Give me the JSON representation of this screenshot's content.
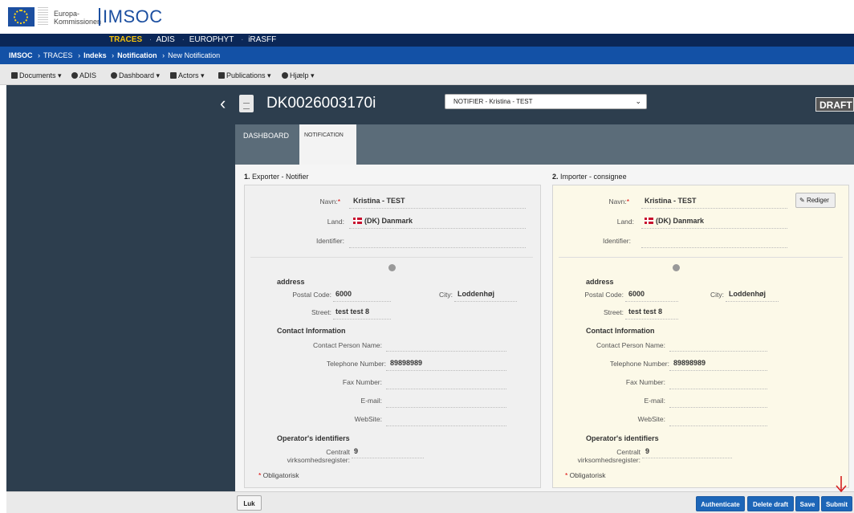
{
  "brand": {
    "line1": "Europa-",
    "line2": "Kommissionen",
    "app": "IMSOC"
  },
  "apps": {
    "active": "TRACES",
    "items": [
      "ADIS",
      "EUROPHYT",
      "iRASFF"
    ]
  },
  "breadcrumb": {
    "root": "IMSOC",
    "traces": "TRACES",
    "index": "Indeks",
    "notification": "Notification",
    "current": "New Notification"
  },
  "menu": {
    "documents": "Documents ▾",
    "adis": "ADIS",
    "dashboard": "Dashboard ▾",
    "actors": "Actors ▾",
    "publications": "Publications ▾",
    "help": "Hjælp ▾"
  },
  "header": {
    "certificate_id": "DK0026003170i",
    "role_select": "NOTIFIER - Kristina - TEST",
    "status": "DRAFT"
  },
  "tabs": {
    "dashboard": "DASHBOARD",
    "notification": "NOTIFICATION"
  },
  "exporter": {
    "section_num": "1.",
    "section_title": "Exporter - Notifier",
    "name_label": "Navn:",
    "name": "Kristina - TEST",
    "country_label": "Land:",
    "country": "(DK) Danmark",
    "identifier_label": "Identifier:",
    "address_heading": "address",
    "postal_code_label": "Postal Code:",
    "postal_code": "6000",
    "city_label": "City:",
    "city": "Loddenhøj",
    "street_label": "Street:",
    "street": "test test 8",
    "contact_heading": "Contact Information",
    "contact_person_label": "Contact Person Name:",
    "telephone_label": "Telephone Number:",
    "telephone": "89898989",
    "fax_label": "Fax Number:",
    "email_label": "E-mail:",
    "website_label": "WebSite:",
    "operator_heading": "Operator's identifiers",
    "cvr_label_1": "Centralt",
    "cvr_label_2": "virksomhedsregister:",
    "cvr": "9",
    "required_note": "Obligatorisk"
  },
  "importer": {
    "section_num": "2.",
    "section_title": "Importer - consignee",
    "edit_button": "Rediger",
    "name_label": "Navn:",
    "name": "Kristina - TEST",
    "country_label": "Land:",
    "country": "(DK) Danmark",
    "identifier_label": "Identifier:",
    "address_heading": "address",
    "postal_code_label": "Postal Code:",
    "postal_code": "6000",
    "city_label": "City:",
    "city": "Loddenhøj",
    "street_label": "Street:",
    "street": "test test 8",
    "contact_heading": "Contact Information",
    "contact_person_label": "Contact Person Name:",
    "telephone_label": "Telephone Number:",
    "telephone": "89898989",
    "fax_label": "Fax Number:",
    "email_label": "E-mail:",
    "website_label": "WebSite:",
    "operator_heading": "Operator's identifiers",
    "cvr_label_1": "Centralt",
    "cvr_label_2": "virksomhedsregister:",
    "cvr": "9",
    "required_note": "Obligatorisk"
  },
  "footer": {
    "close": "Luk",
    "authenticate": "Authenticate",
    "delete_draft": "Delete draft",
    "save": "Save",
    "submit": "Submit"
  },
  "colors": {
    "brand_blue": "#1351a6",
    "dark_panel": "#2d3e4e",
    "button_blue": "#1d66b8",
    "arrow_red": "#d62020"
  }
}
